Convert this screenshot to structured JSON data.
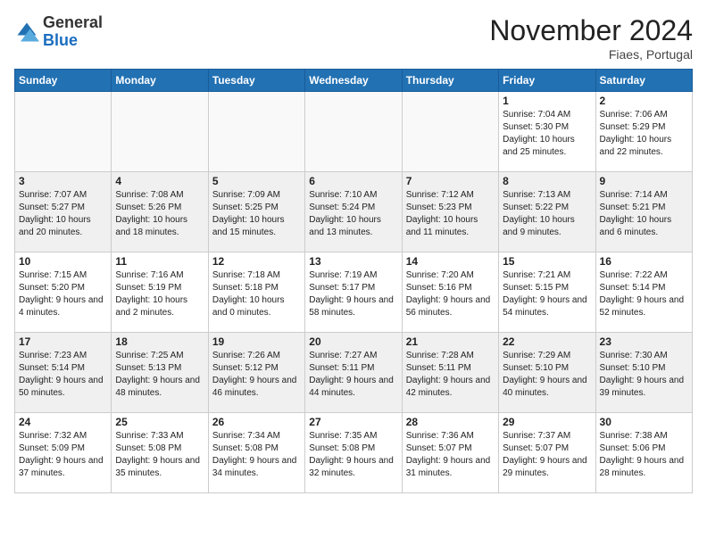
{
  "header": {
    "logo_general": "General",
    "logo_blue": "Blue",
    "month_title": "November 2024",
    "location": "Fiaes, Portugal"
  },
  "days_of_week": [
    "Sunday",
    "Monday",
    "Tuesday",
    "Wednesday",
    "Thursday",
    "Friday",
    "Saturday"
  ],
  "weeks": [
    [
      {
        "day": "",
        "empty": true
      },
      {
        "day": "",
        "empty": true
      },
      {
        "day": "",
        "empty": true
      },
      {
        "day": "",
        "empty": true
      },
      {
        "day": "",
        "empty": true
      },
      {
        "day": "1",
        "sunrise": "7:04 AM",
        "sunset": "5:30 PM",
        "daylight": "10 hours and 25 minutes."
      },
      {
        "day": "2",
        "sunrise": "7:06 AM",
        "sunset": "5:29 PM",
        "daylight": "10 hours and 22 minutes."
      }
    ],
    [
      {
        "day": "3",
        "sunrise": "7:07 AM",
        "sunset": "5:27 PM",
        "daylight": "10 hours and 20 minutes."
      },
      {
        "day": "4",
        "sunrise": "7:08 AM",
        "sunset": "5:26 PM",
        "daylight": "10 hours and 18 minutes."
      },
      {
        "day": "5",
        "sunrise": "7:09 AM",
        "sunset": "5:25 PM",
        "daylight": "10 hours and 15 minutes."
      },
      {
        "day": "6",
        "sunrise": "7:10 AM",
        "sunset": "5:24 PM",
        "daylight": "10 hours and 13 minutes."
      },
      {
        "day": "7",
        "sunrise": "7:12 AM",
        "sunset": "5:23 PM",
        "daylight": "10 hours and 11 minutes."
      },
      {
        "day": "8",
        "sunrise": "7:13 AM",
        "sunset": "5:22 PM",
        "daylight": "10 hours and 9 minutes."
      },
      {
        "day": "9",
        "sunrise": "7:14 AM",
        "sunset": "5:21 PM",
        "daylight": "10 hours and 6 minutes."
      }
    ],
    [
      {
        "day": "10",
        "sunrise": "7:15 AM",
        "sunset": "5:20 PM",
        "daylight": "9 hours and 4 minutes."
      },
      {
        "day": "11",
        "sunrise": "7:16 AM",
        "sunset": "5:19 PM",
        "daylight": "10 hours and 2 minutes."
      },
      {
        "day": "12",
        "sunrise": "7:18 AM",
        "sunset": "5:18 PM",
        "daylight": "10 hours and 0 minutes."
      },
      {
        "day": "13",
        "sunrise": "7:19 AM",
        "sunset": "5:17 PM",
        "daylight": "9 hours and 58 minutes."
      },
      {
        "day": "14",
        "sunrise": "7:20 AM",
        "sunset": "5:16 PM",
        "daylight": "9 hours and 56 minutes."
      },
      {
        "day": "15",
        "sunrise": "7:21 AM",
        "sunset": "5:15 PM",
        "daylight": "9 hours and 54 minutes."
      },
      {
        "day": "16",
        "sunrise": "7:22 AM",
        "sunset": "5:14 PM",
        "daylight": "9 hours and 52 minutes."
      }
    ],
    [
      {
        "day": "17",
        "sunrise": "7:23 AM",
        "sunset": "5:14 PM",
        "daylight": "9 hours and 50 minutes."
      },
      {
        "day": "18",
        "sunrise": "7:25 AM",
        "sunset": "5:13 PM",
        "daylight": "9 hours and 48 minutes."
      },
      {
        "day": "19",
        "sunrise": "7:26 AM",
        "sunset": "5:12 PM",
        "daylight": "9 hours and 46 minutes."
      },
      {
        "day": "20",
        "sunrise": "7:27 AM",
        "sunset": "5:11 PM",
        "daylight": "9 hours and 44 minutes."
      },
      {
        "day": "21",
        "sunrise": "7:28 AM",
        "sunset": "5:11 PM",
        "daylight": "9 hours and 42 minutes."
      },
      {
        "day": "22",
        "sunrise": "7:29 AM",
        "sunset": "5:10 PM",
        "daylight": "9 hours and 40 minutes."
      },
      {
        "day": "23",
        "sunrise": "7:30 AM",
        "sunset": "5:10 PM",
        "daylight": "9 hours and 39 minutes."
      }
    ],
    [
      {
        "day": "24",
        "sunrise": "7:32 AM",
        "sunset": "5:09 PM",
        "daylight": "9 hours and 37 minutes."
      },
      {
        "day": "25",
        "sunrise": "7:33 AM",
        "sunset": "5:08 PM",
        "daylight": "9 hours and 35 minutes."
      },
      {
        "day": "26",
        "sunrise": "7:34 AM",
        "sunset": "5:08 PM",
        "daylight": "9 hours and 34 minutes."
      },
      {
        "day": "27",
        "sunrise": "7:35 AM",
        "sunset": "5:08 PM",
        "daylight": "9 hours and 32 minutes."
      },
      {
        "day": "28",
        "sunrise": "7:36 AM",
        "sunset": "5:07 PM",
        "daylight": "9 hours and 31 minutes."
      },
      {
        "day": "29",
        "sunrise": "7:37 AM",
        "sunset": "5:07 PM",
        "daylight": "9 hours and 29 minutes."
      },
      {
        "day": "30",
        "sunrise": "7:38 AM",
        "sunset": "5:06 PM",
        "daylight": "9 hours and 28 minutes."
      }
    ]
  ]
}
